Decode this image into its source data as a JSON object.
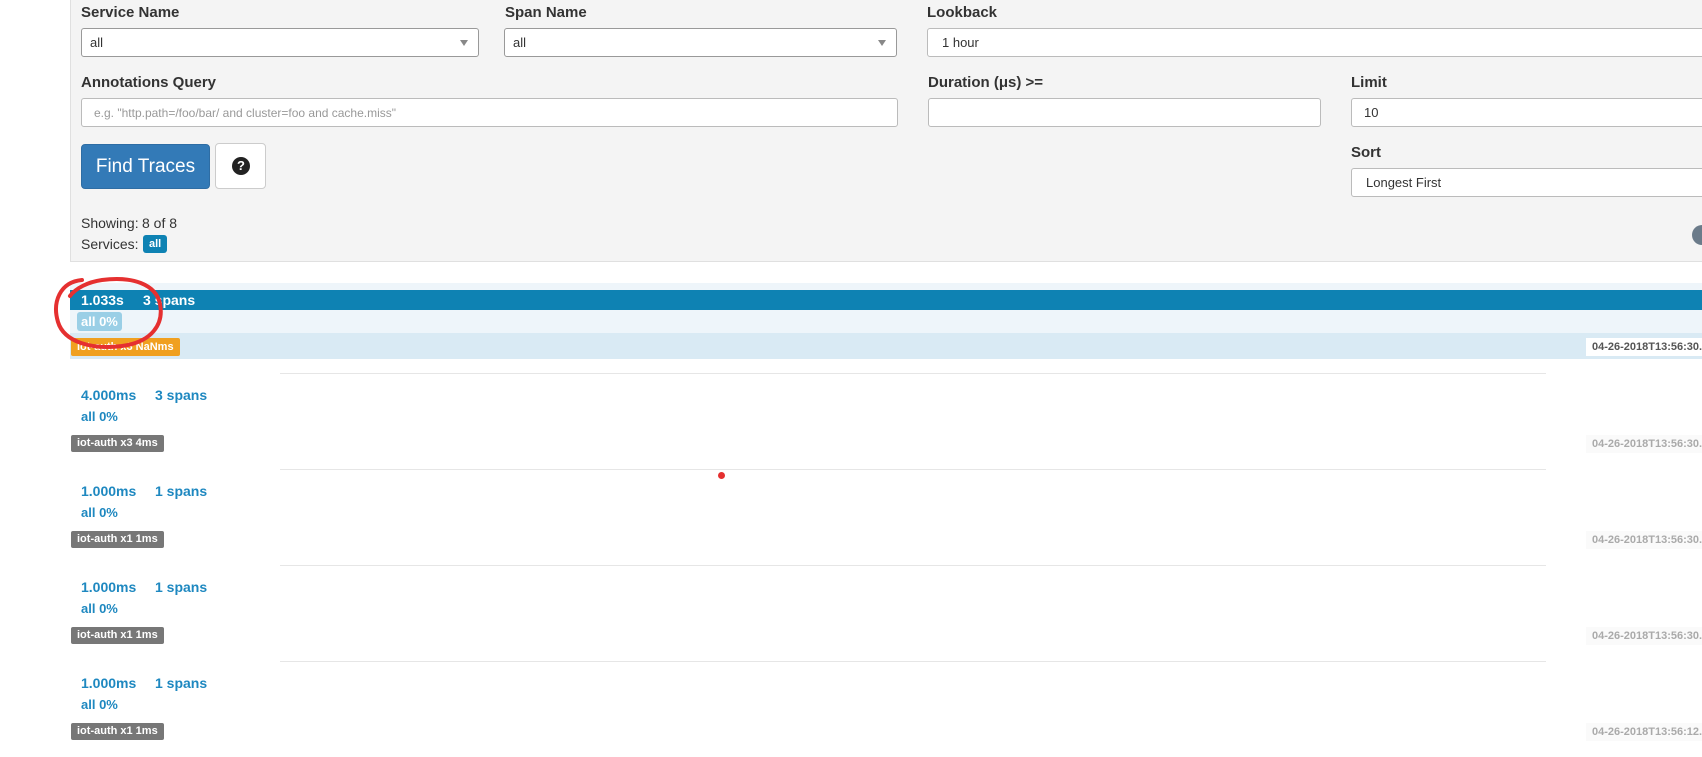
{
  "search": {
    "service_name": {
      "label": "Service Name",
      "value": "all"
    },
    "span_name": {
      "label": "Span Name",
      "value": "all"
    },
    "lookback": {
      "label": "Lookback",
      "value": "1 hour"
    },
    "annotations_query": {
      "label": "Annotations Query",
      "placeholder": "e.g. \"http.path=/foo/bar/ and cluster=foo and cache.miss\""
    },
    "duration": {
      "label": "Duration (μs) >=",
      "value": ""
    },
    "limit": {
      "label": "Limit",
      "value": "10"
    },
    "sort": {
      "label": "Sort",
      "value": "Longest First"
    },
    "find_button": "Find Traces",
    "help_icon": "question-circle-icon",
    "help_glyph": "?"
  },
  "summary": {
    "showing_label": "Showing:",
    "showing_value": "8 of 8",
    "services_label": "Services:",
    "services_badge": "all"
  },
  "traces": [
    {
      "duration": "1.033s",
      "spans": "3 spans",
      "percent": "all 0%",
      "service_badge": "iot-auth x3 NaNms",
      "timestamp": "04-26-2018T13:56:30.",
      "highlighted": true
    },
    {
      "duration": "4.000ms",
      "spans": "3 spans",
      "percent": "all 0%",
      "service_badge": "iot-auth x3 4ms",
      "timestamp": "04-26-2018T13:56:30."
    },
    {
      "duration": "1.000ms",
      "spans": "1 spans",
      "percent": "all 0%",
      "service_badge": "iot-auth x1 1ms",
      "timestamp": "04-26-2018T13:56:30."
    },
    {
      "duration": "1.000ms",
      "spans": "1 spans",
      "percent": "all 0%",
      "service_badge": "iot-auth x1 1ms",
      "timestamp": "04-26-2018T13:56:30."
    },
    {
      "duration": "1.000ms",
      "spans": "1 spans",
      "percent": "all 0%",
      "service_badge": "iot-auth x1 1ms",
      "timestamp": "04-26-2018T13:56:12."
    }
  ],
  "colors": {
    "primary_button": "#337ab7",
    "trace_bar": "#0e82b3",
    "warn_badge": "#f0a020",
    "service_badge": "#777777",
    "annotation_stroke": "#e53030"
  }
}
